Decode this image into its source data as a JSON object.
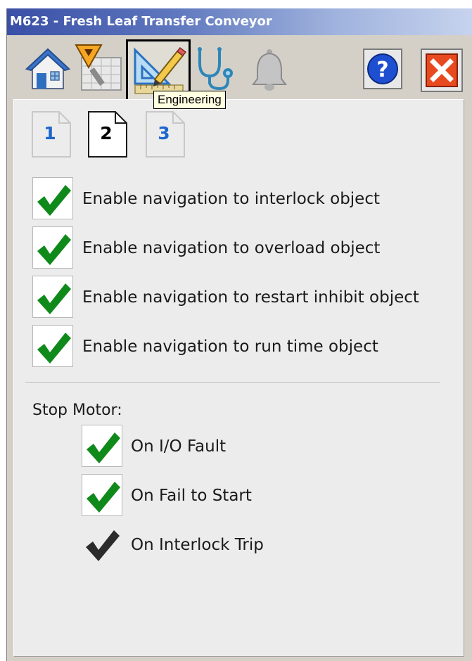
{
  "window": {
    "title": "M623 - Fresh Leaf Transfer Conveyor"
  },
  "toolbar": {
    "buttons": [
      {
        "name": "home",
        "icon": "home-icon"
      },
      {
        "name": "maintenance",
        "icon": "maintenance-calendar-icon"
      },
      {
        "name": "engineering",
        "icon": "engineering-icon",
        "selected": true
      },
      {
        "name": "diagnostics",
        "icon": "stethoscope-icon"
      },
      {
        "name": "alarms",
        "icon": "bell-icon"
      },
      {
        "name": "help",
        "icon": "help-icon"
      },
      {
        "name": "close",
        "icon": "close-icon"
      }
    ],
    "tooltip": "Engineering"
  },
  "pages": {
    "tabs": [
      {
        "label": "1",
        "active": false
      },
      {
        "label": "2",
        "active": true
      },
      {
        "label": "3",
        "active": false
      }
    ]
  },
  "navigation": {
    "options": [
      {
        "label": "Enable navigation to interlock object",
        "checked": true
      },
      {
        "label": "Enable navigation to overload object",
        "checked": true
      },
      {
        "label": "Enable navigation to restart inhibit object",
        "checked": true
      },
      {
        "label": "Enable navigation to run time object",
        "checked": true
      }
    ]
  },
  "stop_motor": {
    "label": "Stop Motor:",
    "options": [
      {
        "label": "On I/O Fault",
        "checked": true,
        "enabled": true
      },
      {
        "label": "On Fail to Start",
        "checked": true,
        "enabled": true
      },
      {
        "label": "On Interlock Trip",
        "checked": true,
        "enabled": false
      }
    ]
  },
  "colors": {
    "title_bar": "#3a4fa6",
    "check_green": "#0f8a1a",
    "check_disabled": "#2b2b2b",
    "tab_blue": "#1a66cc",
    "close_red": "#e84a1f",
    "help_blue": "#1f4fd1"
  }
}
